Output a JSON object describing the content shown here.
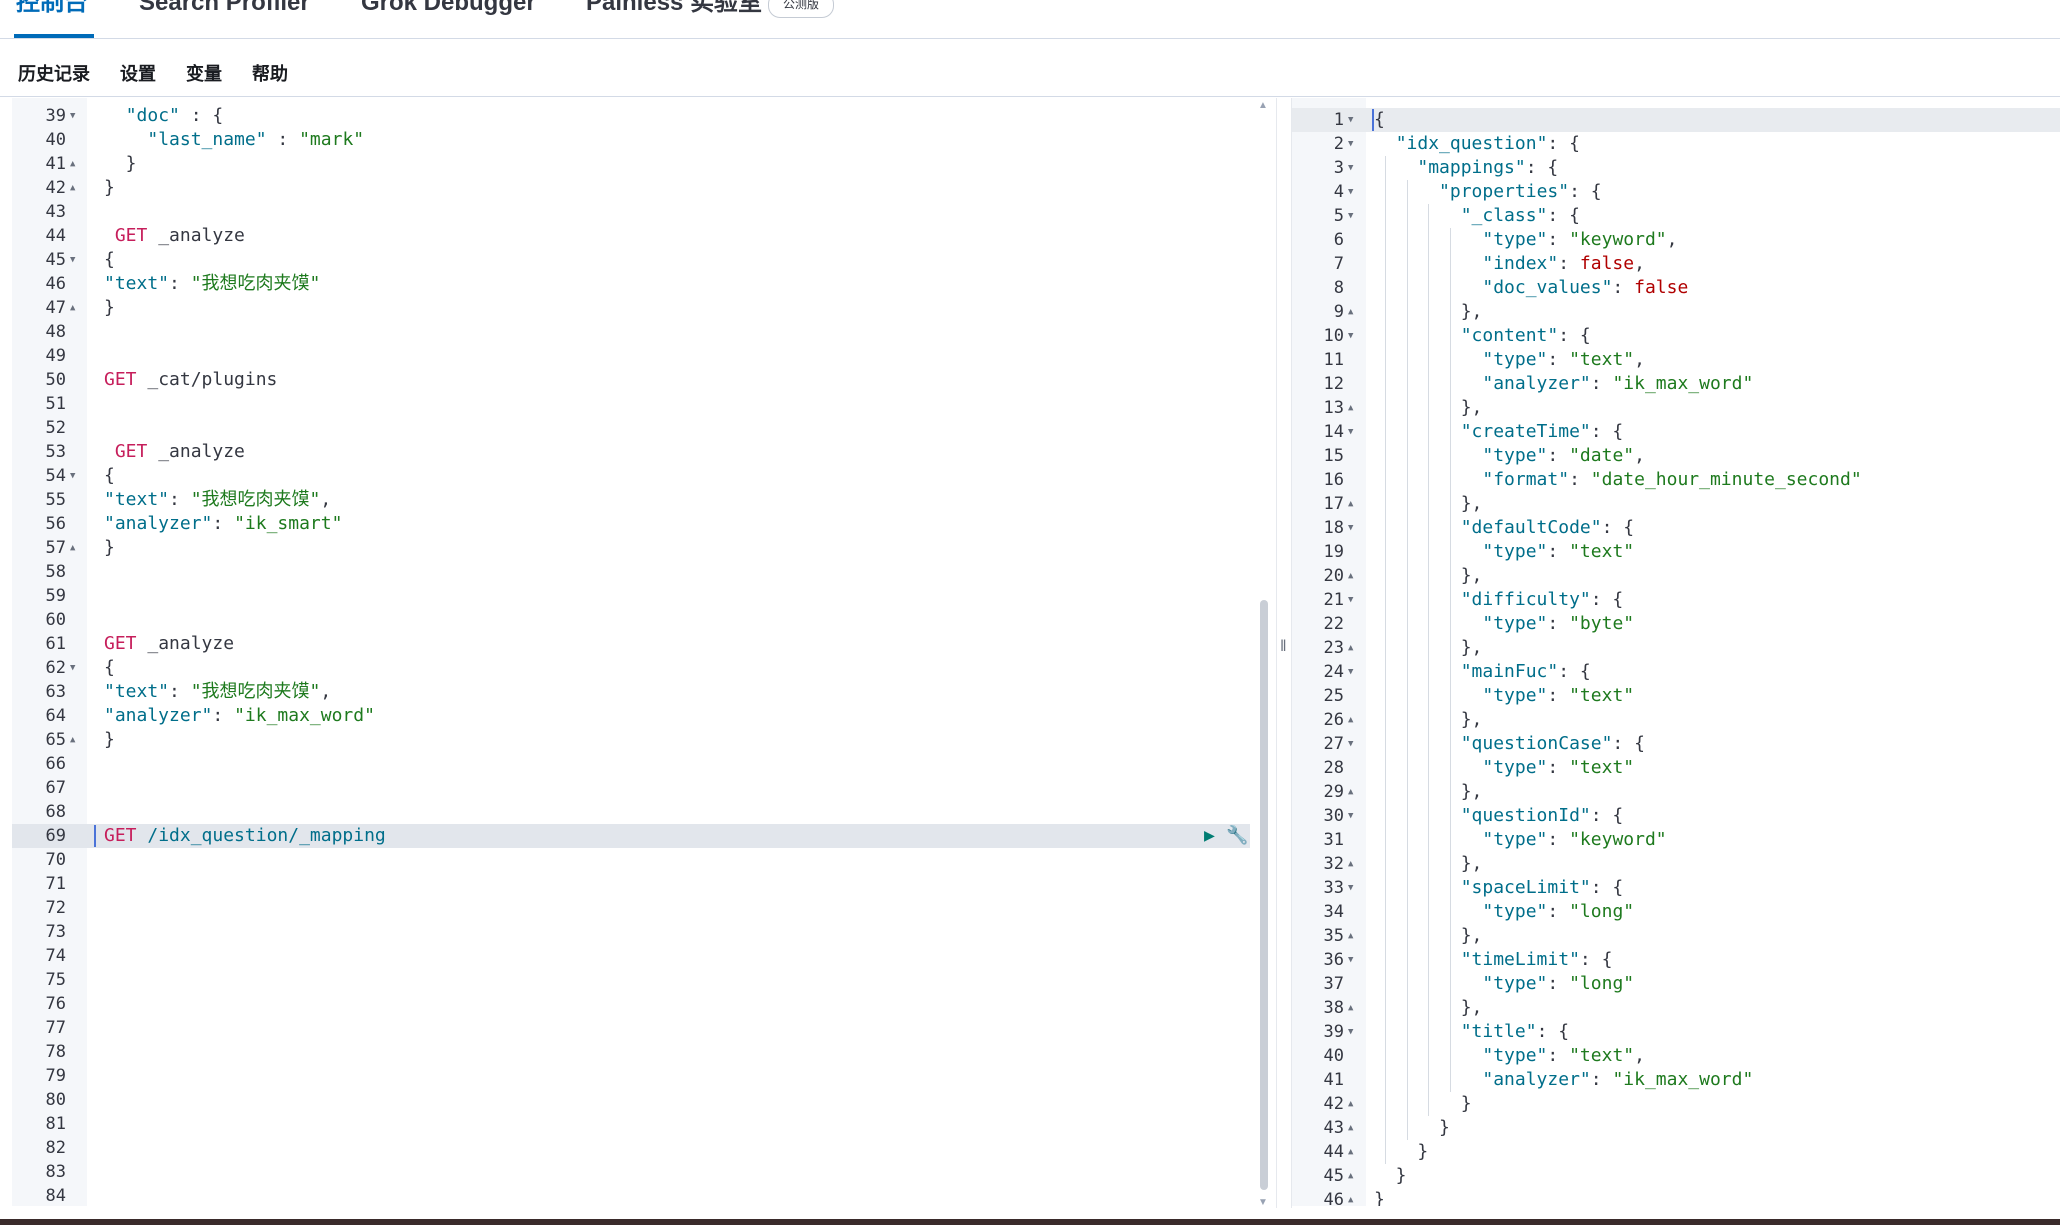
{
  "tabs": [
    {
      "label": "控制台"
    },
    {
      "label": "Search Profiler"
    },
    {
      "label": "Grok Debugger"
    },
    {
      "label": "Painless 实验室"
    }
  ],
  "beta_badge": "公测版",
  "menu": [
    "历史记录",
    "设置",
    "变量",
    "帮助"
  ],
  "left_editor": {
    "lines": [
      {
        "n": "39",
        "fold": "▼",
        "tokens": [
          [
            "p",
            "  "
          ],
          [
            "k",
            "\"doc\""
          ],
          [
            "p",
            " : {"
          ]
        ]
      },
      {
        "n": "40",
        "fold": "",
        "tokens": [
          [
            "p",
            "    "
          ],
          [
            "k",
            "\"last_name\""
          ],
          [
            "p",
            " : "
          ],
          [
            "s",
            "\"mark\""
          ]
        ]
      },
      {
        "n": "41",
        "fold": "▲",
        "tokens": [
          [
            "p",
            "  }"
          ]
        ]
      },
      {
        "n": "42",
        "fold": "▲",
        "tokens": [
          [
            "p",
            "}"
          ]
        ]
      },
      {
        "n": "43",
        "fold": "",
        "tokens": []
      },
      {
        "n": "44",
        "fold": "",
        "tokens": [
          [
            "p",
            " "
          ],
          [
            "m",
            "GET"
          ],
          [
            "p",
            " _analyze"
          ]
        ]
      },
      {
        "n": "45",
        "fold": "▼",
        "tokens": [
          [
            "p",
            "{"
          ]
        ]
      },
      {
        "n": "46",
        "fold": "",
        "tokens": [
          [
            "k",
            "\"text\""
          ],
          [
            "p",
            ": "
          ],
          [
            "s",
            "\"我想吃肉夹馍\""
          ]
        ]
      },
      {
        "n": "47",
        "fold": "▲",
        "tokens": [
          [
            "p",
            "}"
          ]
        ]
      },
      {
        "n": "48",
        "fold": "",
        "tokens": []
      },
      {
        "n": "49",
        "fold": "",
        "tokens": []
      },
      {
        "n": "50",
        "fold": "",
        "tokens": [
          [
            "m",
            "GET"
          ],
          [
            "p",
            " _cat/plugins"
          ]
        ]
      },
      {
        "n": "51",
        "fold": "",
        "tokens": []
      },
      {
        "n": "52",
        "fold": "",
        "tokens": []
      },
      {
        "n": "53",
        "fold": "",
        "tokens": [
          [
            "p",
            " "
          ],
          [
            "m",
            "GET"
          ],
          [
            "p",
            " _analyze"
          ]
        ]
      },
      {
        "n": "54",
        "fold": "▼",
        "tokens": [
          [
            "p",
            "{"
          ]
        ]
      },
      {
        "n": "55",
        "fold": "",
        "tokens": [
          [
            "k",
            "\"text\""
          ],
          [
            "p",
            ": "
          ],
          [
            "s",
            "\"我想吃肉夹馍\""
          ],
          [
            "p",
            ","
          ]
        ]
      },
      {
        "n": "56",
        "fold": "",
        "tokens": [
          [
            "k",
            "\"analyzer\""
          ],
          [
            "p",
            ": "
          ],
          [
            "s",
            "\"ik_smart\""
          ]
        ]
      },
      {
        "n": "57",
        "fold": "▲",
        "tokens": [
          [
            "p",
            "}"
          ]
        ]
      },
      {
        "n": "58",
        "fold": "",
        "tokens": []
      },
      {
        "n": "59",
        "fold": "",
        "tokens": []
      },
      {
        "n": "60",
        "fold": "",
        "tokens": []
      },
      {
        "n": "61",
        "fold": "",
        "tokens": [
          [
            "m",
            "GET"
          ],
          [
            "p",
            " _analyze"
          ]
        ]
      },
      {
        "n": "62",
        "fold": "▼",
        "tokens": [
          [
            "p",
            "{"
          ]
        ]
      },
      {
        "n": "63",
        "fold": "",
        "tokens": [
          [
            "k",
            "\"text\""
          ],
          [
            "p",
            ": "
          ],
          [
            "s",
            "\"我想吃肉夹馍\""
          ],
          [
            "p",
            ","
          ]
        ]
      },
      {
        "n": "64",
        "fold": "",
        "tokens": [
          [
            "k",
            "\"analyzer\""
          ],
          [
            "p",
            ": "
          ],
          [
            "s",
            "\"ik_max_word\""
          ]
        ]
      },
      {
        "n": "65",
        "fold": "▲",
        "tokens": [
          [
            "p",
            "}"
          ]
        ]
      },
      {
        "n": "66",
        "fold": "",
        "tokens": []
      },
      {
        "n": "67",
        "fold": "",
        "tokens": []
      },
      {
        "n": "68",
        "fold": "",
        "tokens": []
      },
      {
        "n": "69",
        "fold": "",
        "tokens": [
          [
            "m",
            "GET"
          ],
          [
            "p",
            " "
          ],
          [
            "u",
            "/idx_question/_mapping"
          ]
        ]
      },
      {
        "n": "70",
        "fold": "",
        "tokens": []
      },
      {
        "n": "71",
        "fold": "",
        "tokens": []
      },
      {
        "n": "72",
        "fold": "",
        "tokens": []
      },
      {
        "n": "73",
        "fold": "",
        "tokens": []
      },
      {
        "n": "74",
        "fold": "",
        "tokens": []
      },
      {
        "n": "75",
        "fold": "",
        "tokens": []
      },
      {
        "n": "76",
        "fold": "",
        "tokens": []
      },
      {
        "n": "77",
        "fold": "",
        "tokens": []
      },
      {
        "n": "78",
        "fold": "",
        "tokens": []
      },
      {
        "n": "79",
        "fold": "",
        "tokens": []
      },
      {
        "n": "80",
        "fold": "",
        "tokens": []
      },
      {
        "n": "81",
        "fold": "",
        "tokens": []
      },
      {
        "n": "82",
        "fold": "",
        "tokens": []
      },
      {
        "n": "83",
        "fold": "",
        "tokens": []
      },
      {
        "n": "84",
        "fold": "",
        "tokens": []
      }
    ],
    "active_line": "69"
  },
  "right_editor": {
    "lines": [
      {
        "n": "1",
        "fold": "▼",
        "tokens": [
          [
            "p",
            "{"
          ]
        ]
      },
      {
        "n": "2",
        "fold": "▼",
        "tokens": [
          [
            "p",
            "  "
          ],
          [
            "k",
            "\"idx_question\""
          ],
          [
            "p",
            ": {"
          ]
        ]
      },
      {
        "n": "3",
        "fold": "▼",
        "tokens": [
          [
            "p",
            "    "
          ],
          [
            "k",
            "\"mappings\""
          ],
          [
            "p",
            ": {"
          ]
        ]
      },
      {
        "n": "4",
        "fold": "▼",
        "tokens": [
          [
            "p",
            "      "
          ],
          [
            "k",
            "\"properties\""
          ],
          [
            "p",
            ": {"
          ]
        ]
      },
      {
        "n": "5",
        "fold": "▼",
        "tokens": [
          [
            "p",
            "        "
          ],
          [
            "k",
            "\"_class\""
          ],
          [
            "p",
            ": {"
          ]
        ]
      },
      {
        "n": "6",
        "fold": "",
        "tokens": [
          [
            "p",
            "          "
          ],
          [
            "k",
            "\"type\""
          ],
          [
            "p",
            ": "
          ],
          [
            "s",
            "\"keyword\""
          ],
          [
            "p",
            ","
          ]
        ]
      },
      {
        "n": "7",
        "fold": "",
        "tokens": [
          [
            "p",
            "          "
          ],
          [
            "k",
            "\"index\""
          ],
          [
            "p",
            ": "
          ],
          [
            "b",
            "false"
          ],
          [
            "p",
            ","
          ]
        ]
      },
      {
        "n": "8",
        "fold": "",
        "tokens": [
          [
            "p",
            "          "
          ],
          [
            "k",
            "\"doc_values\""
          ],
          [
            "p",
            ": "
          ],
          [
            "b",
            "false"
          ]
        ]
      },
      {
        "n": "9",
        "fold": "▲",
        "tokens": [
          [
            "p",
            "        },"
          ]
        ]
      },
      {
        "n": "10",
        "fold": "▼",
        "tokens": [
          [
            "p",
            "        "
          ],
          [
            "k",
            "\"content\""
          ],
          [
            "p",
            ": {"
          ]
        ]
      },
      {
        "n": "11",
        "fold": "",
        "tokens": [
          [
            "p",
            "          "
          ],
          [
            "k",
            "\"type\""
          ],
          [
            "p",
            ": "
          ],
          [
            "s",
            "\"text\""
          ],
          [
            "p",
            ","
          ]
        ]
      },
      {
        "n": "12",
        "fold": "",
        "tokens": [
          [
            "p",
            "          "
          ],
          [
            "k",
            "\"analyzer\""
          ],
          [
            "p",
            ": "
          ],
          [
            "s",
            "\"ik_max_word\""
          ]
        ]
      },
      {
        "n": "13",
        "fold": "▲",
        "tokens": [
          [
            "p",
            "        },"
          ]
        ]
      },
      {
        "n": "14",
        "fold": "▼",
        "tokens": [
          [
            "p",
            "        "
          ],
          [
            "k",
            "\"createTime\""
          ],
          [
            "p",
            ": {"
          ]
        ]
      },
      {
        "n": "15",
        "fold": "",
        "tokens": [
          [
            "p",
            "          "
          ],
          [
            "k",
            "\"type\""
          ],
          [
            "p",
            ": "
          ],
          [
            "s",
            "\"date\""
          ],
          [
            "p",
            ","
          ]
        ]
      },
      {
        "n": "16",
        "fold": "",
        "tokens": [
          [
            "p",
            "          "
          ],
          [
            "k",
            "\"format\""
          ],
          [
            "p",
            ": "
          ],
          [
            "s",
            "\"date_hour_minute_second\""
          ]
        ]
      },
      {
        "n": "17",
        "fold": "▲",
        "tokens": [
          [
            "p",
            "        },"
          ]
        ]
      },
      {
        "n": "18",
        "fold": "▼",
        "tokens": [
          [
            "p",
            "        "
          ],
          [
            "k",
            "\"defaultCode\""
          ],
          [
            "p",
            ": {"
          ]
        ]
      },
      {
        "n": "19",
        "fold": "",
        "tokens": [
          [
            "p",
            "          "
          ],
          [
            "k",
            "\"type\""
          ],
          [
            "p",
            ": "
          ],
          [
            "s",
            "\"text\""
          ]
        ]
      },
      {
        "n": "20",
        "fold": "▲",
        "tokens": [
          [
            "p",
            "        },"
          ]
        ]
      },
      {
        "n": "21",
        "fold": "▼",
        "tokens": [
          [
            "p",
            "        "
          ],
          [
            "k",
            "\"difficulty\""
          ],
          [
            "p",
            ": {"
          ]
        ]
      },
      {
        "n": "22",
        "fold": "",
        "tokens": [
          [
            "p",
            "          "
          ],
          [
            "k",
            "\"type\""
          ],
          [
            "p",
            ": "
          ],
          [
            "s",
            "\"byte\""
          ]
        ]
      },
      {
        "n": "23",
        "fold": "▲",
        "tokens": [
          [
            "p",
            "        },"
          ]
        ]
      },
      {
        "n": "24",
        "fold": "▼",
        "tokens": [
          [
            "p",
            "        "
          ],
          [
            "k",
            "\"mainFuc\""
          ],
          [
            "p",
            ": {"
          ]
        ]
      },
      {
        "n": "25",
        "fold": "",
        "tokens": [
          [
            "p",
            "          "
          ],
          [
            "k",
            "\"type\""
          ],
          [
            "p",
            ": "
          ],
          [
            "s",
            "\"text\""
          ]
        ]
      },
      {
        "n": "26",
        "fold": "▲",
        "tokens": [
          [
            "p",
            "        },"
          ]
        ]
      },
      {
        "n": "27",
        "fold": "▼",
        "tokens": [
          [
            "p",
            "        "
          ],
          [
            "k",
            "\"questionCase\""
          ],
          [
            "p",
            ": {"
          ]
        ]
      },
      {
        "n": "28",
        "fold": "",
        "tokens": [
          [
            "p",
            "          "
          ],
          [
            "k",
            "\"type\""
          ],
          [
            "p",
            ": "
          ],
          [
            "s",
            "\"text\""
          ]
        ]
      },
      {
        "n": "29",
        "fold": "▲",
        "tokens": [
          [
            "p",
            "        },"
          ]
        ]
      },
      {
        "n": "30",
        "fold": "▼",
        "tokens": [
          [
            "p",
            "        "
          ],
          [
            "k",
            "\"questionId\""
          ],
          [
            "p",
            ": {"
          ]
        ]
      },
      {
        "n": "31",
        "fold": "",
        "tokens": [
          [
            "p",
            "          "
          ],
          [
            "k",
            "\"type\""
          ],
          [
            "p",
            ": "
          ],
          [
            "s",
            "\"keyword\""
          ]
        ]
      },
      {
        "n": "32",
        "fold": "▲",
        "tokens": [
          [
            "p",
            "        },"
          ]
        ]
      },
      {
        "n": "33",
        "fold": "▼",
        "tokens": [
          [
            "p",
            "        "
          ],
          [
            "k",
            "\"spaceLimit\""
          ],
          [
            "p",
            ": {"
          ]
        ]
      },
      {
        "n": "34",
        "fold": "",
        "tokens": [
          [
            "p",
            "          "
          ],
          [
            "k",
            "\"type\""
          ],
          [
            "p",
            ": "
          ],
          [
            "s",
            "\"long\""
          ]
        ]
      },
      {
        "n": "35",
        "fold": "▲",
        "tokens": [
          [
            "p",
            "        },"
          ]
        ]
      },
      {
        "n": "36",
        "fold": "▼",
        "tokens": [
          [
            "p",
            "        "
          ],
          [
            "k",
            "\"timeLimit\""
          ],
          [
            "p",
            ": {"
          ]
        ]
      },
      {
        "n": "37",
        "fold": "",
        "tokens": [
          [
            "p",
            "          "
          ],
          [
            "k",
            "\"type\""
          ],
          [
            "p",
            ": "
          ],
          [
            "s",
            "\"long\""
          ]
        ]
      },
      {
        "n": "38",
        "fold": "▲",
        "tokens": [
          [
            "p",
            "        },"
          ]
        ]
      },
      {
        "n": "39",
        "fold": "▼",
        "tokens": [
          [
            "p",
            "        "
          ],
          [
            "k",
            "\"title\""
          ],
          [
            "p",
            ": {"
          ]
        ]
      },
      {
        "n": "40",
        "fold": "",
        "tokens": [
          [
            "p",
            "          "
          ],
          [
            "k",
            "\"type\""
          ],
          [
            "p",
            ": "
          ],
          [
            "s",
            "\"text\""
          ],
          [
            "p",
            ","
          ]
        ]
      },
      {
        "n": "41",
        "fold": "",
        "tokens": [
          [
            "p",
            "          "
          ],
          [
            "k",
            "\"analyzer\""
          ],
          [
            "p",
            ": "
          ],
          [
            "s",
            "\"ik_max_word\""
          ]
        ]
      },
      {
        "n": "42",
        "fold": "▲",
        "tokens": [
          [
            "p",
            "        }"
          ]
        ]
      },
      {
        "n": "43",
        "fold": "▲",
        "tokens": [
          [
            "p",
            "      }"
          ]
        ]
      },
      {
        "n": "44",
        "fold": "▲",
        "tokens": [
          [
            "p",
            "    }"
          ]
        ]
      },
      {
        "n": "45",
        "fold": "▲",
        "tokens": [
          [
            "p",
            "  }"
          ]
        ]
      },
      {
        "n": "46",
        "fold": "▲",
        "tokens": [
          [
            "p",
            "}"
          ]
        ]
      }
    ]
  },
  "colors": {
    "accent": "#006bb8",
    "method": "#c61e5b",
    "string": "#1e7a1e",
    "key": "#006e8a",
    "boolean": "#b00000",
    "play": "#017d73"
  },
  "icons": {
    "play": "play-icon",
    "wrench": "wrench-icon",
    "splitter": "resize-handle-icon"
  }
}
